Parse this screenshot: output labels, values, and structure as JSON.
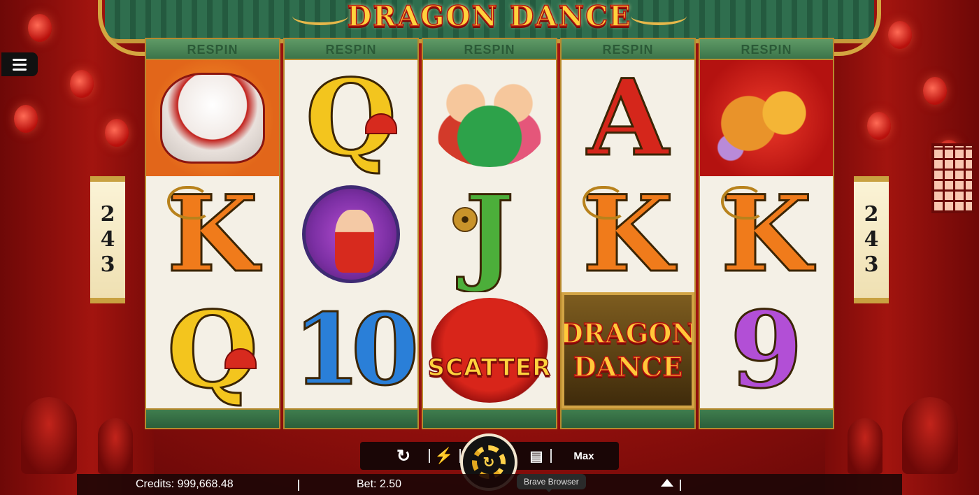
{
  "game": {
    "title": "DRAGON DANCE"
  },
  "ways": {
    "left_digits": [
      "2",
      "4",
      "3"
    ],
    "right_digits": [
      "2",
      "4",
      "3"
    ]
  },
  "reels": [
    {
      "respin_label": "RESPIN",
      "symbols": [
        "lion-dance",
        "K",
        "Q"
      ]
    },
    {
      "respin_label": "RESPIN",
      "symbols": [
        "Q",
        "cymbal-woman",
        "10"
      ]
    },
    {
      "respin_label": "RESPIN",
      "symbols": [
        "dancers",
        "J",
        "scatter"
      ]
    },
    {
      "respin_label": "RESPIN",
      "symbols": [
        "A",
        "K",
        "dragon-dance-logo"
      ]
    },
    {
      "respin_label": "RESPIN",
      "symbols": [
        "dragon",
        "K",
        "9"
      ]
    }
  ],
  "symbols_text": {
    "q": "Q",
    "k": "K",
    "a": "A",
    "j": "J",
    "ten": "10",
    "nine": "9",
    "scatter": "SCATTER",
    "logo_line1": "DRAGON",
    "logo_line2": "DANCE"
  },
  "controls": {
    "autoplay_icon": "autoplay-icon",
    "turbo_icon": "lightning-icon",
    "spin_icon": "spin-arrow-icon",
    "coins_icon": "coin-stack-icon",
    "max_label": "Max"
  },
  "status": {
    "credits": "Credits: 999,668.48",
    "bet": "Bet: 2.50"
  },
  "tooltip": {
    "text": "Brave Browser"
  },
  "colors": {
    "background": "#a2140f",
    "reel_header": "#3b744a",
    "gold": "#c9a141"
  }
}
